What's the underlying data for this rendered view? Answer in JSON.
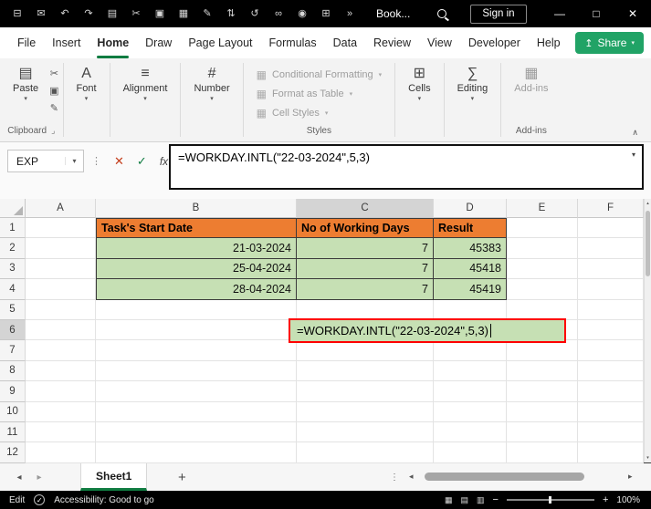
{
  "titlebar": {
    "workbook_name": "Book...",
    "sign_in_label": "Sign in",
    "qat_icons": [
      {
        "name": "save-icon",
        "glyph": "⊟"
      },
      {
        "name": "email-icon",
        "glyph": "✉"
      },
      {
        "name": "undo-icon",
        "glyph": "↶"
      },
      {
        "name": "redo-icon",
        "glyph": "↷"
      },
      {
        "name": "paste-icon",
        "glyph": "▤"
      },
      {
        "name": "cut-icon",
        "glyph": "✂"
      },
      {
        "name": "copy-icon",
        "glyph": "▣"
      },
      {
        "name": "chart-icon",
        "glyph": "▦"
      },
      {
        "name": "format-painter-icon",
        "glyph": "✎"
      },
      {
        "name": "sort-icon",
        "glyph": "⇅"
      },
      {
        "name": "undo-history-icon",
        "glyph": "↺"
      },
      {
        "name": "link-icon",
        "glyph": "∞"
      },
      {
        "name": "camera-icon",
        "glyph": "◉"
      },
      {
        "name": "table-icon",
        "glyph": "⊞"
      },
      {
        "name": "more-commands-icon",
        "glyph": "»"
      }
    ]
  },
  "menu": {
    "tabs": [
      "File",
      "Insert",
      "Home",
      "Draw",
      "Page Layout",
      "Formulas",
      "Data",
      "Review",
      "View",
      "Developer",
      "Help"
    ],
    "active_tab": "Home",
    "share_label": "Share"
  },
  "ribbon": {
    "paste_label": "Paste",
    "clipboard_group_label": "Clipboard",
    "font_label": "Font",
    "alignment_label": "Alignment",
    "number_label": "Number",
    "styles_items": [
      "Conditional Formatting",
      "Format as Table",
      "Cell Styles"
    ],
    "styles_group_label": "Styles",
    "cells_label": "Cells",
    "editing_label": "Editing",
    "addins_label": "Add-ins",
    "addins_group_label": "Add-ins"
  },
  "formula_bar": {
    "name_box_value": "EXP",
    "formula": "=WORKDAY.INTL(\"22-03-2024\",5,3)"
  },
  "grid": {
    "column_headers": [
      "A",
      "B",
      "C",
      "D",
      "E",
      "F"
    ],
    "row_headers": [
      "1",
      "2",
      "3",
      "4",
      "5",
      "6",
      "7",
      "8",
      "9",
      "10",
      "11",
      "12"
    ],
    "highlighted_column": "C",
    "highlighted_row": "6",
    "cells": [
      {
        "ref": "B1",
        "text": "Task's Start Date",
        "format": "header",
        "align": "left"
      },
      {
        "ref": "C1",
        "text": "No of Working Days",
        "format": "header",
        "align": "left"
      },
      {
        "ref": "D1",
        "text": "Result",
        "format": "header",
        "align": "left"
      },
      {
        "ref": "B2",
        "text": "21-03-2024",
        "format": "green",
        "align": "right"
      },
      {
        "ref": "C2",
        "text": "7",
        "format": "green",
        "align": "right"
      },
      {
        "ref": "D2",
        "text": "45383",
        "format": "green",
        "align": "right"
      },
      {
        "ref": "B3",
        "text": "25-04-2024",
        "format": "green",
        "align": "right"
      },
      {
        "ref": "C3",
        "text": "7",
        "format": "green",
        "align": "right"
      },
      {
        "ref": "D3",
        "text": "45418",
        "format": "green",
        "align": "right"
      },
      {
        "ref": "B4",
        "text": "28-04-2024",
        "format": "green",
        "align": "right"
      },
      {
        "ref": "C4",
        "text": "7",
        "format": "green",
        "align": "right"
      },
      {
        "ref": "D4",
        "text": "45419",
        "format": "green",
        "align": "right"
      }
    ],
    "editing_cell": {
      "ref": "C6",
      "text": "=WORKDAY.INTL(\"22-03-2024\",5,3)"
    }
  },
  "sheet_bar": {
    "active_tab": "Sheet1",
    "new_sheet_label": "+"
  },
  "status_bar": {
    "mode": "Edit",
    "accessibility_text": "Accessibility: Good to go",
    "zoom_level": "100%"
  },
  "icons": {
    "dropdown": "▾",
    "collapse": "∧",
    "dialog_launcher": "⌟",
    "paste": "▤",
    "cut": "✂",
    "copy": "▣",
    "format_painter": "✎",
    "font": "A",
    "alignment": "≡",
    "number": "#",
    "styles_item": "▦",
    "cells": "⊞",
    "editing": "∑",
    "addins": "▦",
    "cancel": "✕",
    "enter": "✓",
    "function": "fx",
    "formula_expand": "▾",
    "scroll_up": "▴",
    "scroll_down": "▾",
    "scroll_left": "◂",
    "scroll_right": "▸",
    "prev_sheet": "◂",
    "next_sheet": "▸",
    "tab_dots": "⋮",
    "drag_dots": "⋮",
    "accessibility": "✓",
    "view_normal": "▦",
    "view_page_layout": "▤",
    "view_page_break": "▥",
    "zoom_out": "−",
    "zoom_in": "+",
    "share": "↥",
    "minimize": "—",
    "maximize": "□",
    "close": "✕"
  },
  "colors": {
    "table_header_fill": "#ED7D31",
    "table_data_fill": "#C6E0B4",
    "edit_highlight_border": "#FF0000",
    "excel_green": "#107C41",
    "share_button_green": "#21A366",
    "titlebar_bg": "#000000",
    "statusbar_bg": "#000000"
  }
}
